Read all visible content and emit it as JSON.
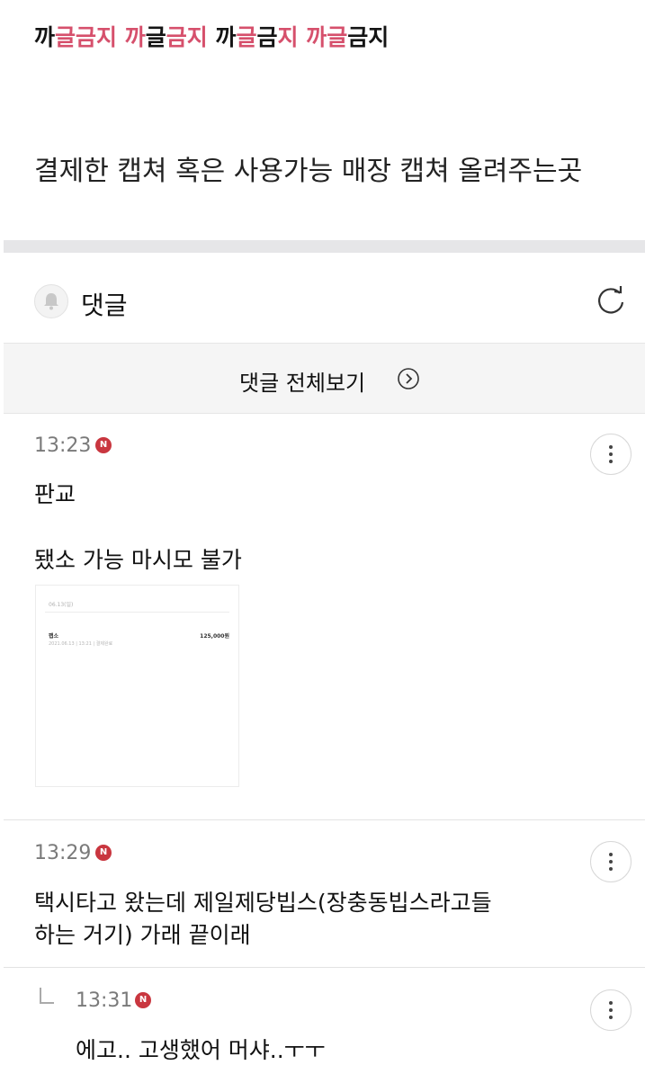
{
  "post": {
    "top_segments": [
      {
        "text": "까",
        "color": "#141414"
      },
      {
        "text": "글금지 ",
        "color": "#d6506c"
      },
      {
        "text": "까",
        "color": "#d6506c"
      },
      {
        "text": "글",
        "color": "#141414"
      },
      {
        "text": "금지 ",
        "color": "#d6506c"
      },
      {
        "text": "까",
        "color": "#141414"
      },
      {
        "text": "글",
        "color": "#d6506c"
      },
      {
        "text": "금",
        "color": "#141414"
      },
      {
        "text": "지 ",
        "color": "#d6506c"
      },
      {
        "text": "까글",
        "color": "#d6506c"
      },
      {
        "text": "금",
        "color": "#141414"
      },
      {
        "text": "지",
        "color": "#141414"
      }
    ],
    "headline": "결제한 캡쳐 혹은 사용가능 매장 캡쳐 올려주는곳"
  },
  "comments_section": {
    "title": "댓글",
    "view_all_label": "댓글 전체보기"
  },
  "comments": [
    {
      "time": "13:23",
      "badge": "N",
      "line1": "판교",
      "line2": "됐소 가능 마시모 불가",
      "attachment": {
        "date": "06.13(일)",
        "item": "팹소",
        "amount": "125,000원",
        "sub": "2021.06.13 | 13:21 | 결제완료"
      }
    },
    {
      "time": "13:29",
      "badge": "N",
      "line1": "택시타고 왔는데 제일제당빕스(장충동빕스라고들",
      "line2": "하는 거기) 가래 끝이래"
    },
    {
      "time": "13:31",
      "badge": "N",
      "line1": "에고.. 고생했어 머샤..ㅜㅜ"
    }
  ],
  "icons": {
    "bell": "bell-icon",
    "refresh": "refresh-icon",
    "view_all": "chevron-right-circle-icon",
    "more": "more-vertical-icon"
  }
}
